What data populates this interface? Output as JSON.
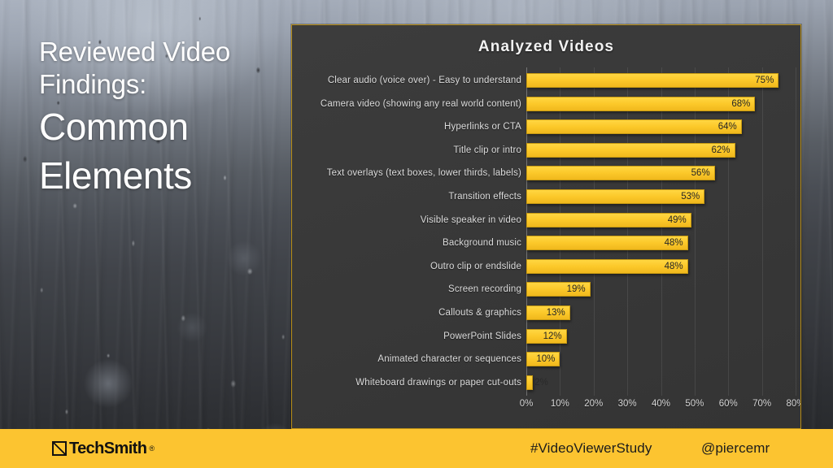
{
  "slide": {
    "title_line1": "Reviewed Video",
    "title_line2": "Findings:",
    "title_line3": "Common",
    "title_line4": "Elements"
  },
  "chart_panel": {
    "title": "Analyzed Videos"
  },
  "footer": {
    "logo_text": "TechSmith",
    "logo_registered": "®",
    "hashtag": "#VideoViewerStudy",
    "handle": "@piercemr"
  },
  "colors": {
    "bar_fill": "#fcc92a",
    "bar_border": "#c79a12",
    "panel_bg": "#393939",
    "panel_border": "#b98f18",
    "footer_bg": "#fcc430",
    "label_text": "#dcdcdc",
    "title_text": "#f2f2f2"
  },
  "chart_data": {
    "type": "bar",
    "orientation": "horizontal",
    "title": "Analyzed Videos",
    "xlabel": "",
    "ylabel": "",
    "xlim": [
      0,
      80
    ],
    "grid": true,
    "legend": false,
    "xticks": [
      "0%",
      "10%",
      "20%",
      "30%",
      "40%",
      "50%",
      "60%",
      "70%",
      "80%"
    ],
    "xtick_values": [
      0,
      10,
      20,
      30,
      40,
      50,
      60,
      70,
      80
    ],
    "categories": [
      "Clear audio (voice over) - Easy to understand",
      "Camera video (showing any real world content)",
      "Hyperlinks or CTA",
      "Title clip or intro",
      "Text overlays (text boxes, lower thirds, labels)",
      "Transition effects",
      "Visible speaker in video",
      "Background music",
      "Outro clip or endslide",
      "Screen recording",
      "Callouts & graphics",
      "PowerPoint Slides",
      "Animated character or sequences",
      "Whiteboard drawings or paper cut-outs"
    ],
    "values": [
      75,
      68,
      64,
      62,
      56,
      53,
      49,
      48,
      48,
      19,
      13,
      12,
      10,
      2
    ],
    "data_labels": [
      "75%",
      "68%",
      "64%",
      "62%",
      "56%",
      "53%",
      "49%",
      "48%",
      "48%",
      "19%",
      "13%",
      "12%",
      "10%",
      "2%"
    ]
  }
}
